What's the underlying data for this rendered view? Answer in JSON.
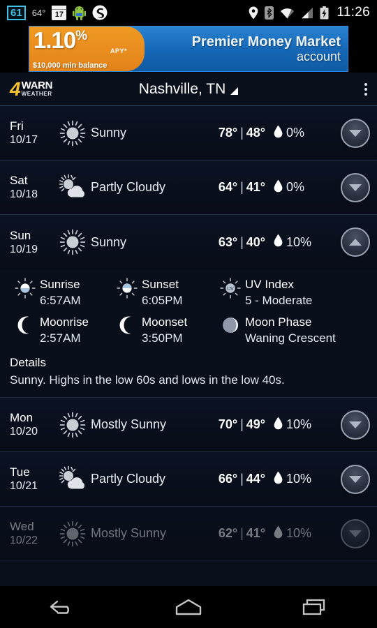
{
  "statusbar": {
    "badge": "61",
    "temp": "64°",
    "calendar_day": "17",
    "android_icon": "android-robot-icon",
    "s_icon": "s-logo-icon",
    "location_icon": "location-pin-icon",
    "bluetooth_icon": "bluetooth-icon",
    "wifi_icon": "wifi-icon",
    "signal_icon": "cell-signal-icon",
    "battery_icon": "battery-charging-icon",
    "time": "11:26"
  },
  "ad": {
    "rate": "1.10",
    "percent": "%",
    "apy": "APY*",
    "min_balance": "$10,000 min balance",
    "line1": "Premier Money Market",
    "line2": "account"
  },
  "header": {
    "logo_number": "4",
    "logo_warn": "WARN",
    "logo_weather": "WEATHER",
    "location": "Nashville, TN",
    "dropdown_icon": "triangle-down-icon",
    "overflow_icon": "overflow-menu-icon"
  },
  "forecast": [
    {
      "day": "Fri",
      "date": "10/17",
      "icon": "sunny-icon",
      "condition": "Sunny",
      "high": "78°",
      "low": "48°",
      "precip": "0%",
      "expanded": false,
      "faded": false
    },
    {
      "day": "Sat",
      "date": "10/18",
      "icon": "partly-cloudy-icon",
      "condition": "Partly Cloudy",
      "high": "64°",
      "low": "41°",
      "precip": "0%",
      "expanded": false,
      "faded": false
    },
    {
      "day": "Sun",
      "date": "10/19",
      "icon": "sunny-icon",
      "condition": "Sunny",
      "high": "63°",
      "low": "40°",
      "precip": "10%",
      "expanded": true,
      "faded": false
    },
    {
      "day": "Mon",
      "date": "10/20",
      "icon": "mostly-sunny-icon",
      "condition": "Mostly Sunny",
      "high": "70°",
      "low": "49°",
      "precip": "10%",
      "expanded": false,
      "faded": false
    },
    {
      "day": "Tue",
      "date": "10/21",
      "icon": "partly-cloudy-icon",
      "condition": "Partly Cloudy",
      "high": "66°",
      "low": "44°",
      "precip": "10%",
      "expanded": false,
      "faded": false
    },
    {
      "day": "Wed",
      "date": "10/22",
      "icon": "mostly-sunny-icon",
      "condition": "Mostly Sunny",
      "high": "62°",
      "low": "41°",
      "precip": "10%",
      "expanded": false,
      "faded": true
    }
  ],
  "expanded_detail": {
    "sunrise_label": "Sunrise",
    "sunrise_value": "6:57AM",
    "sunset_label": "Sunset",
    "sunset_value": "6:05PM",
    "uv_label": "UV Index",
    "uv_value": "5 - Moderate",
    "moonrise_label": "Moonrise",
    "moonrise_value": "2:57AM",
    "moonset_label": "Moonset",
    "moonset_value": "3:50PM",
    "moonphase_label": "Moon Phase",
    "moonphase_value": "Waning Crescent",
    "details_heading": "Details",
    "details_text": "Sunny. Highs in the low 60s and lows in the low 40s."
  },
  "separator": "|",
  "navbar": {
    "back": "back-icon",
    "home": "home-icon",
    "recents": "recents-icon"
  },
  "colors": {
    "accent_blue": "#1b72c4",
    "accent_orange": "#e2821a",
    "logo_gold": "#f2c230",
    "badge_cyan": "#3fc4e8",
    "app_bg": "#080d18"
  }
}
